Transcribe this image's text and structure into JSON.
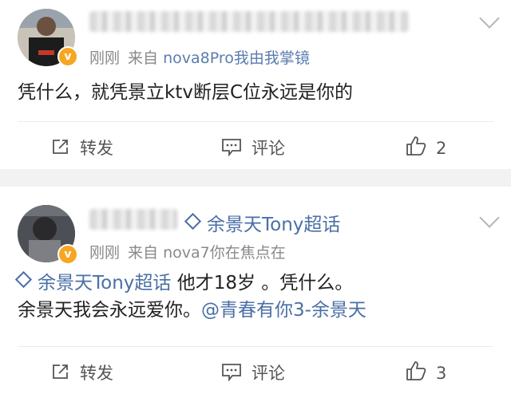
{
  "posts": [
    {
      "username": "",
      "time": "刚刚",
      "source_prefix": "来自",
      "device": "nova8Pro我由我掌镜",
      "verified_badge": "v",
      "content": "凭什么，就凭景立ktv断层C位永远是你的",
      "actions": {
        "repost": "转发",
        "comment": "评论",
        "like_count": "2"
      }
    },
    {
      "username": "",
      "supertopic": "余景天Tony超话",
      "time": "刚刚",
      "source_prefix": "来自",
      "device": "nova7你在焦点在",
      "verified_badge": "v",
      "content_tag": "余景天Tony超话",
      "content_line1": " 他才18岁 。凭什么。",
      "content_line2_text": "余景天我会永远爱你。",
      "content_mention": "@青春有你3-余景天",
      "actions": {
        "repost": "转发",
        "comment": "评论",
        "like_count": "3"
      }
    }
  ],
  "colors": {
    "link": "#4a6fa5",
    "meta": "#8a8a8a",
    "badge": "#f6a623",
    "separator": "#f2f2f2"
  }
}
